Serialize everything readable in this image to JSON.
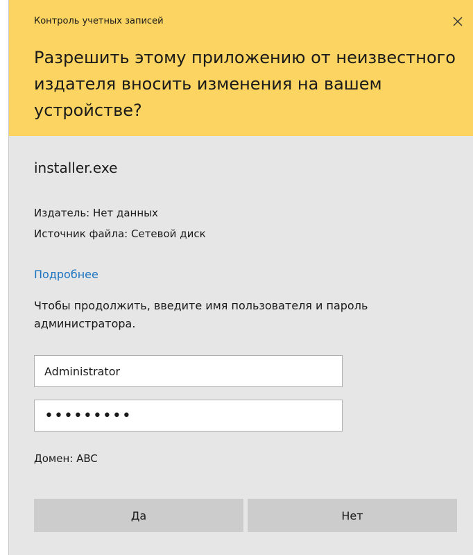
{
  "dialog": {
    "caption": "Контроль учетных записей",
    "question": "Разрешить этому приложению от неизвестного издателя вносить изменения на вашем устройстве?",
    "header_color": "#fcd462",
    "close_icon": "close-icon"
  },
  "app": {
    "name": "installer.exe",
    "publisher": "Издатель: Нет данных",
    "source": "Источник файла: Сетевой диск"
  },
  "details_link": "Подробнее",
  "prompt": "Чтобы продолжить, введите имя пользователя и пароль администратора.",
  "credentials": {
    "username_value": "Administrator",
    "password_value": "•••••••••",
    "domain": "Домен: ABC"
  },
  "buttons": {
    "yes": "Да",
    "no": "Нет"
  }
}
